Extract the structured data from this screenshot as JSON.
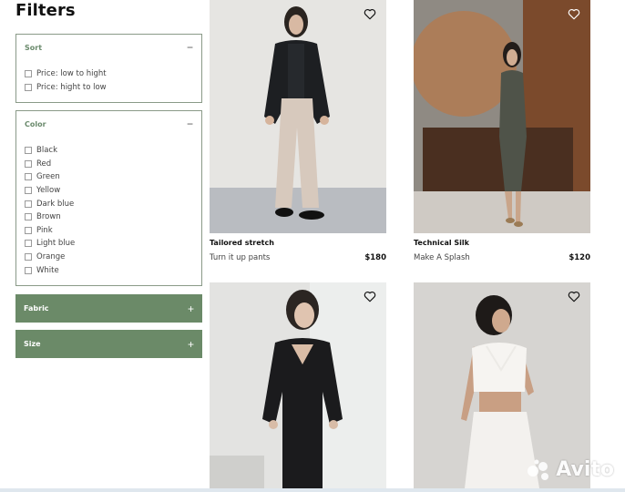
{
  "page": {
    "title": "Filters"
  },
  "sort": {
    "title": "Sort",
    "toggle": "−",
    "options": [
      "Price: low to hight",
      "Price: hight to low"
    ]
  },
  "color": {
    "title": "Color",
    "toggle": "−",
    "options": [
      "Black",
      "Red",
      "Green",
      "Yellow",
      "Dark blue",
      "Brown",
      "Pink",
      "Light blue",
      "Orange",
      "White"
    ]
  },
  "fabric": {
    "title": "Fabric",
    "toggle": "+"
  },
  "size": {
    "title": "Size",
    "toggle": "+"
  },
  "products": [
    {
      "name": "Tailored stretch",
      "subtitle": "Turn it up pants",
      "price": "$180"
    },
    {
      "name": "Technical Silk",
      "subtitle": "Make A Splash",
      "price": "$120"
    },
    {
      "name": "",
      "subtitle": "",
      "price": ""
    },
    {
      "name": "",
      "subtitle": "",
      "price": ""
    }
  ],
  "watermark": {
    "text": "Avito"
  },
  "colors": {
    "accent": "#6b8a68",
    "accent_text": "#6a8a6c",
    "border": "#8a9a88"
  },
  "icons": {
    "favorite": "heart-icon",
    "watermark": "avito-logo-icon"
  }
}
